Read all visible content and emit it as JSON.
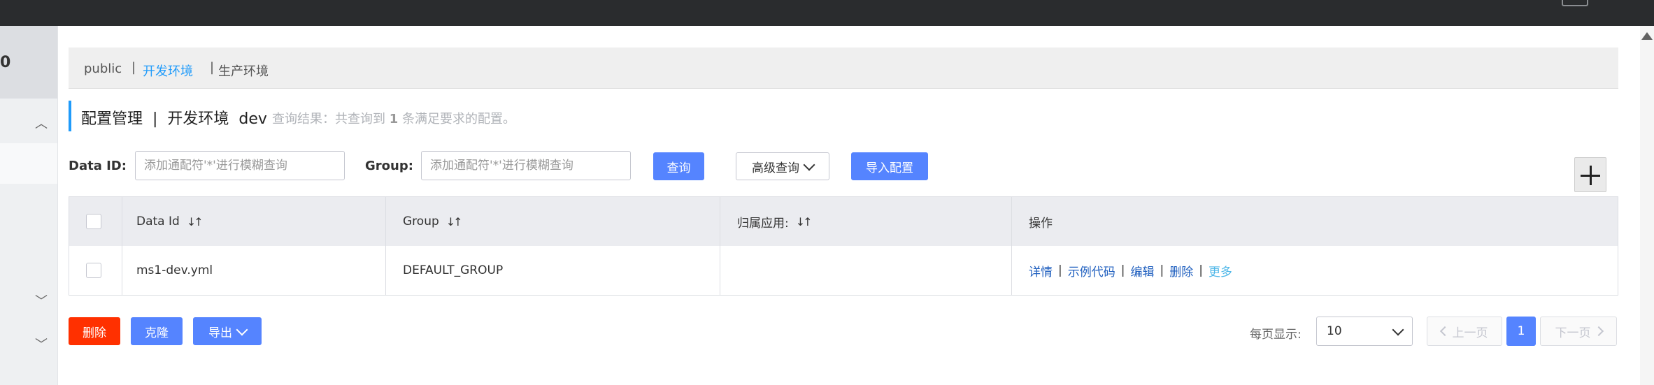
{
  "sidebar": {
    "header_text": "0"
  },
  "namespaces": {
    "items": [
      "public",
      "开发环境",
      "生产环境"
    ],
    "active": "开发环境"
  },
  "page": {
    "title": "配置管理  |  开发环境  dev",
    "result_prefix": "查询结果：共查询到 ",
    "result_count": "1",
    "result_suffix": " 条满足要求的配置。"
  },
  "search": {
    "dataid_label": "Data ID:",
    "dataid_placeholder": "添加通配符'*'进行模糊查询",
    "group_label": "Group:",
    "group_placeholder": "添加通配符'*'进行模糊查询",
    "query_button": "查询",
    "advanced_button": "高级查询",
    "import_button": "导入配置"
  },
  "table": {
    "headers": {
      "data_id": "Data Id",
      "group": "Group",
      "app": "归属应用:",
      "ops": "操作"
    },
    "rows": [
      {
        "data_id": "ms1-dev.yml",
        "group": "DEFAULT_GROUP",
        "app": "",
        "ops": {
          "detail": "详情",
          "sample": "示例代码",
          "edit": "编辑",
          "delete": "删除",
          "more": "更多"
        }
      }
    ]
  },
  "actions": {
    "delete": "删除",
    "clone": "克隆",
    "export": "导出"
  },
  "pagination": {
    "page_size_label": "每页显示:",
    "page_size": "10",
    "prev": "上一页",
    "current": "1",
    "next": "下一页"
  },
  "colors": {
    "primary": "#5584ff",
    "danger": "#ff3000",
    "accent": "#209bfa",
    "topbar": "#2a2c2e"
  },
  "icons": {
    "sort": "sort-icon",
    "plus": "plus-icon",
    "chevron_down": "chevron-down-icon",
    "chevron_up": "chevron-up-icon"
  }
}
